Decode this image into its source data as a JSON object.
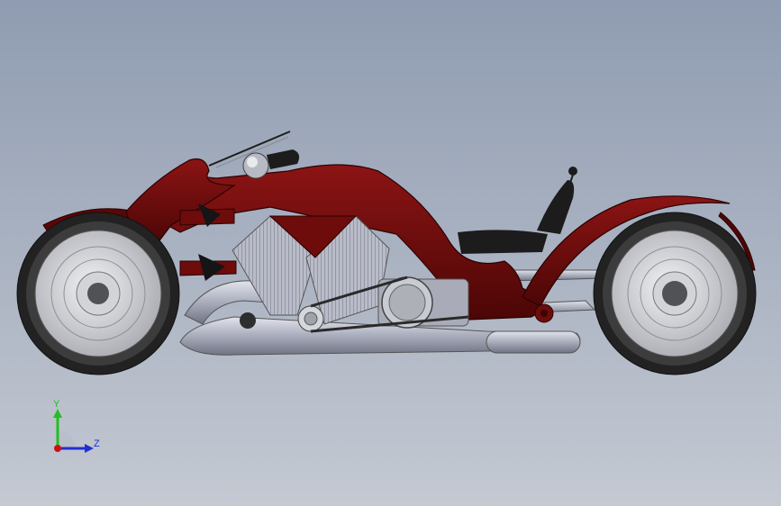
{
  "viewport": {
    "background_top": "#8f9cb1",
    "background_bottom": "#c4c9d2"
  },
  "model": {
    "body_color": "#6e0b0b",
    "engine_color": "#a9acb8",
    "tire_color": "#3a3a3a",
    "seat_color": "#1c1c1c"
  },
  "triad": {
    "y_label": "Y",
    "z_label": "Z",
    "y_color": "#20c020",
    "z_color": "#2030d0",
    "x_color": "#d01010"
  }
}
